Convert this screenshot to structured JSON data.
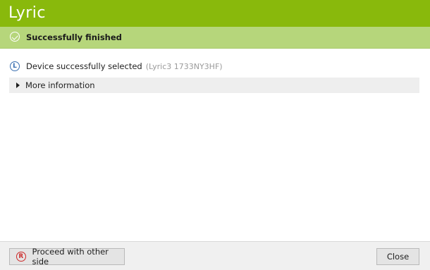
{
  "header": {
    "logo_text": "Lyric",
    "brand_color": "#89b90c"
  },
  "status": {
    "icon": "check-circle-icon",
    "text": "Successfully finished",
    "color": "#b6d67b"
  },
  "device": {
    "icon": "left-device-icon",
    "icon_letter": "L",
    "label": "Device successfully selected",
    "serial": "(Lyric3 1733NY3HF)"
  },
  "more_info": {
    "icon": "expand-arrow-icon",
    "label": "More information"
  },
  "footer": {
    "proceed_icon": "right-device-icon",
    "proceed_icon_letter": "R",
    "proceed_label": "Proceed with other side",
    "close_label": "Close"
  }
}
